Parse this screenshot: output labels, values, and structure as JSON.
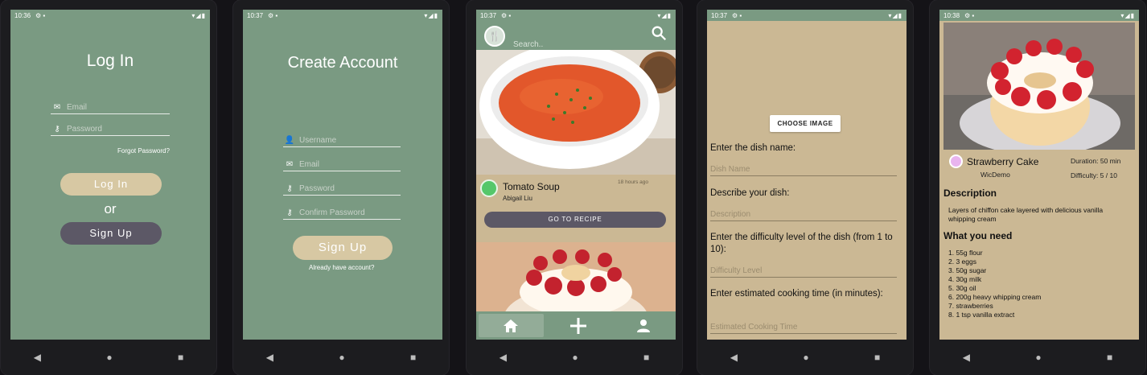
{
  "screens": [
    {
      "status": {
        "time": "10:36"
      },
      "title": "Log In",
      "fields": [
        {
          "icon": "email-icon",
          "placeholder": "Email"
        },
        {
          "icon": "key-icon",
          "placeholder": "Password"
        }
      ],
      "forgot_link": "Forgot Password?",
      "login_button": "Log In",
      "or_text": "or",
      "signup_button": "Sign Up"
    },
    {
      "status": {
        "time": "10:37"
      },
      "title": "Create Account",
      "fields": [
        {
          "icon": "person-icon",
          "placeholder": "Username"
        },
        {
          "icon": "email-icon",
          "placeholder": "Email"
        },
        {
          "icon": "key-icon",
          "placeholder": "Password"
        },
        {
          "icon": "key-icon",
          "placeholder": "Confirm Password"
        }
      ],
      "signup_button": "Sign Up",
      "have_account": "Already have account?"
    },
    {
      "status": {
        "time": "10:37"
      },
      "search_placeholder": "Search..",
      "recipe": {
        "name": "Tomato Soup",
        "author": "Abigail Liu",
        "time_ago": "18 hours ago",
        "button": "GO TO RECIPE"
      }
    },
    {
      "status": {
        "time": "10:37"
      },
      "choose_image": "CHOOSE IMAGE",
      "fields": [
        {
          "label": "Enter the dish name:",
          "placeholder": "Dish Name"
        },
        {
          "label": "Describe your dish:",
          "placeholder": "Description"
        },
        {
          "label": "Enter the difficulty level of the dish (from 1 to 10):",
          "placeholder": "Difficulty Level"
        },
        {
          "label": "Enter estimated cooking time (in minutes):",
          "placeholder": "Estimated Cooking Time"
        }
      ]
    },
    {
      "status": {
        "time": "10:38"
      },
      "title": "Strawberry Cake",
      "author": "WicDemo",
      "duration": "Duration: 50 min",
      "difficulty": "Difficulty: 5 / 10",
      "description_heading": "Description",
      "description": "Layers of chiffon cake layered with delicious vanilla whipping cream",
      "ingredients_heading": "What you need",
      "ingredients": [
        "1.  55g flour",
        "2.  3 eggs",
        "3.  50g sugar",
        "4.  30g milk",
        "5.  30g oil",
        "6.  200g heavy whipping cream",
        "7.  strawberries",
        "8.  1 tsp vanilla extract"
      ]
    }
  ],
  "colors": {
    "sage": "#7a9a82",
    "tan": "#cbb894",
    "dark_button": "#5c5866",
    "light_button": "#d7c8a3"
  }
}
